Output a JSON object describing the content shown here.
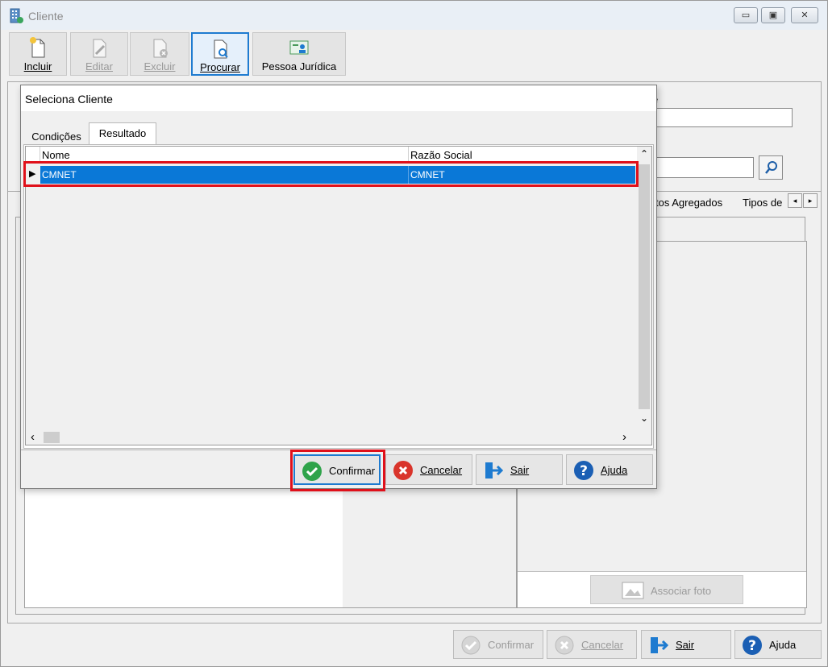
{
  "window": {
    "title": "Cliente",
    "min_glyph": "▭",
    "max_glyph": "▣",
    "close_glyph": "✕"
  },
  "toolbar": {
    "buttons": [
      {
        "label": "Incluir",
        "enabled": true
      },
      {
        "label": "Editar",
        "enabled": false
      },
      {
        "label": "Excluir",
        "enabled": false
      },
      {
        "label": "Procurar",
        "enabled": true,
        "active": true
      },
      {
        "label": "Pessoa Jurídica",
        "enabled": true
      }
    ]
  },
  "main": {
    "partial_label": "e",
    "tabs_partial": [
      "tos Agregados",
      "Tipos de"
    ],
    "tab_scroll_left": "◂",
    "tab_scroll_right": "▸",
    "photo_button": "Associar foto"
  },
  "footer": {
    "confirm": "Confirmar",
    "cancel": "Cancelar",
    "exit": "Sair",
    "help": "Ajuda"
  },
  "dialog": {
    "title": "Seleciona Cliente",
    "tabs": [
      "Condições",
      "Resultado"
    ],
    "active_tab": "Resultado",
    "grid": {
      "columns": [
        "Nome",
        "Razão Social"
      ],
      "rows": [
        {
          "nome": "CMNET",
          "razao_social": "CMNET",
          "selected": true
        }
      ],
      "row_indicator": "▶",
      "scroll_up": "⌃",
      "scroll_down": "⌄",
      "scroll_left": "‹",
      "scroll_right": "›"
    },
    "buttons": {
      "confirm": "Confirmar",
      "cancel": "Cancelar",
      "exit": "Sair",
      "help": "Ajuda"
    }
  },
  "colors": {
    "selection": "#0a78d7",
    "highlight": "#e0101a",
    "confirm_green": "#2fa34a",
    "cancel_red": "#d9342b",
    "help_blue": "#1b5fb4",
    "exit_blue": "#1e7bd0"
  }
}
